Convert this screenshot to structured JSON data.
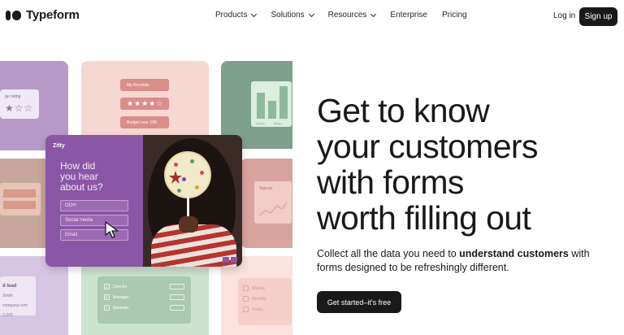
{
  "header": {
    "brand": "Typeform",
    "nav": [
      {
        "label": "Products",
        "has_dropdown": true
      },
      {
        "label": "Solutions",
        "has_dropdown": true
      },
      {
        "label": "Resources",
        "has_dropdown": true
      },
      {
        "label": "Enterprise",
        "has_dropdown": false
      },
      {
        "label": "Pricing",
        "has_dropdown": false
      }
    ],
    "login": "Log in",
    "signup": "Sign up"
  },
  "collage": {
    "rating_card": {
      "label": "ge rating",
      "stars": "★☆☆"
    },
    "pink_pills": [
      "My Revolutz",
      "★★★★☆",
      "Budget over 10K"
    ],
    "chart_card": {
      "labels": [
        "Signups",
        "Budget"
      ]
    },
    "rose_card": {
      "label": "Signals"
    },
    "lead_card": {
      "title": "d lead",
      "lines": [
        "Smith",
        "company.com",
        "2,000"
      ]
    },
    "green_card": {
      "rows": [
        {
          "key": "A",
          "label": "Director"
        },
        {
          "key": "B",
          "label": "Manager"
        },
        {
          "key": "C",
          "label": "Marketer"
        }
      ]
    },
    "pink2_card": {
      "rows": [
        "Weekly",
        "Monthly",
        "Yearly"
      ]
    },
    "form_card": {
      "brand": "Zitty",
      "question_lines": [
        "How did",
        "you hear",
        "about us?"
      ],
      "options": [
        "OOH",
        "Social media",
        "Email"
      ]
    }
  },
  "hero": {
    "title_lines": [
      "Get to know",
      "your customers",
      "with forms",
      "worth filling out"
    ],
    "subtitle_start": "Collect all the data you need to ",
    "subtitle_bold": "understand customers",
    "subtitle_end": " with forms designed to be refreshingly different.",
    "cta": "Get started–it's free"
  },
  "colors": {
    "primary_dark": "#191919",
    "form_purple": "#8b56a6",
    "tile_purple": "#b69ac8",
    "tile_pink": "#f6d7d2",
    "tile_green": "#7f9f8f"
  },
  "icons": [
    "logo-icon",
    "chevron-down-icon",
    "cursor-icon",
    "star-icon"
  ]
}
